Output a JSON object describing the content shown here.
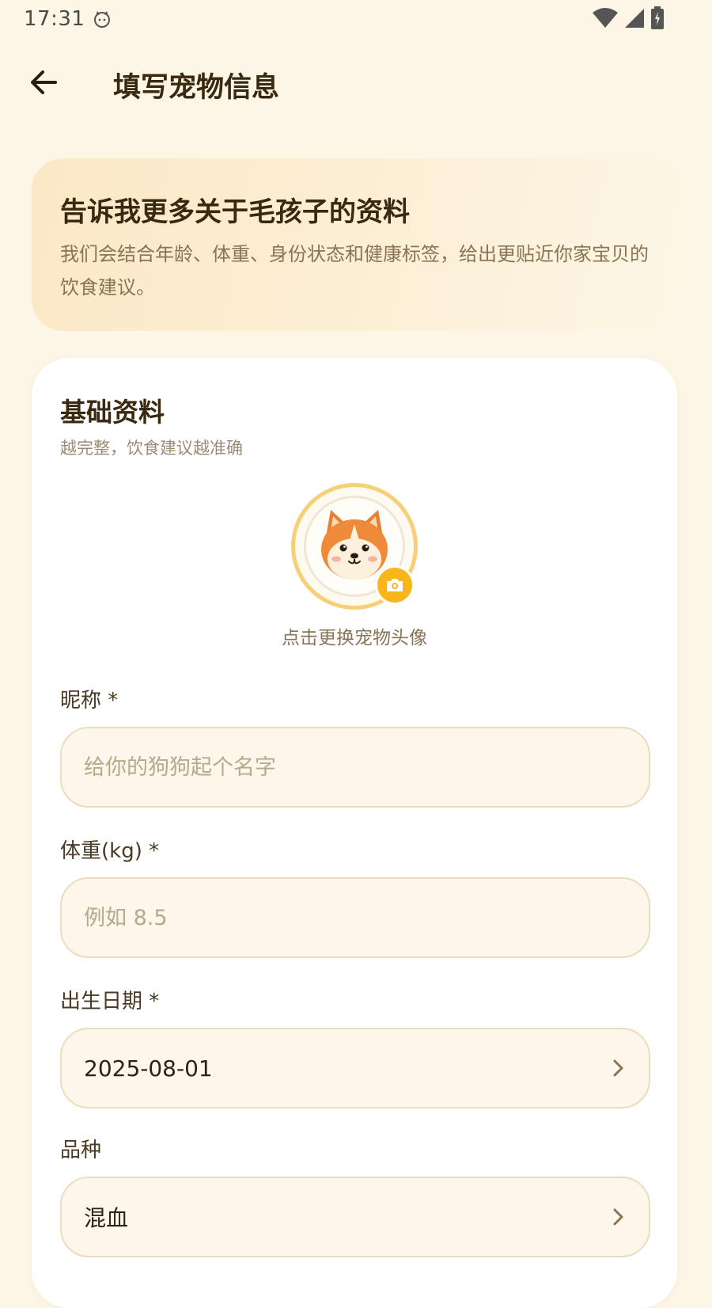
{
  "status_bar": {
    "time": "17:31"
  },
  "app_bar": {
    "title": "填写宠物信息"
  },
  "intro": {
    "title": "告诉我更多关于毛孩子的资料",
    "description": "我们会结合年龄、体重、身份状态和健康标签，给出更贴近你家宝贝的饮食建议。"
  },
  "form": {
    "section_title": "基础资料",
    "section_subtitle": "越完整，饮食建议越准确",
    "avatar_caption": "点击更换宠物头像",
    "nickname": {
      "label": "昵称 *",
      "placeholder": "给你的狗狗起个名字",
      "value": ""
    },
    "weight": {
      "label": "体重(kg) *",
      "placeholder": "例如 8.5",
      "value": ""
    },
    "birthday": {
      "label": "出生日期 *",
      "value": "2025-08-01"
    },
    "breed": {
      "label": "品种",
      "value": "混血"
    }
  },
  "colors": {
    "accent": "#f8b51c",
    "background": "#fdf6e6",
    "ring": "#f6cf77"
  },
  "icons": [
    "back-arrow-icon",
    "wifi-icon",
    "signal-icon",
    "battery-icon",
    "camera-icon",
    "chevron-right-icon",
    "dog-avatar-icon"
  ]
}
